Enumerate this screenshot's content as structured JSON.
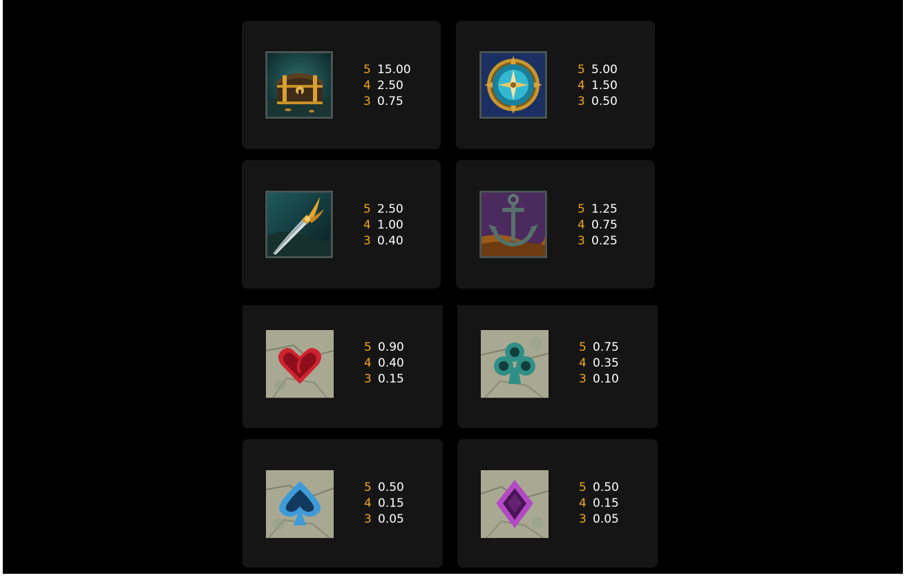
{
  "paytable": {
    "symbols": [
      {
        "name": "treasure-chest",
        "icon": "treasure-chest-icon",
        "pays": [
          {
            "count": "5",
            "value": "15.00"
          },
          {
            "count": "4",
            "value": "2.50"
          },
          {
            "count": "3",
            "value": "0.75"
          }
        ]
      },
      {
        "name": "compass",
        "icon": "compass-icon",
        "pays": [
          {
            "count": "5",
            "value": "5.00"
          },
          {
            "count": "4",
            "value": "1.50"
          },
          {
            "count": "3",
            "value": "0.50"
          }
        ]
      },
      {
        "name": "cutlass",
        "icon": "cutlass-icon",
        "pays": [
          {
            "count": "5",
            "value": "2.50"
          },
          {
            "count": "4",
            "value": "1.00"
          },
          {
            "count": "3",
            "value": "0.40"
          }
        ]
      },
      {
        "name": "anchor",
        "icon": "anchor-icon",
        "pays": [
          {
            "count": "5",
            "value": "1.25"
          },
          {
            "count": "4",
            "value": "0.75"
          },
          {
            "count": "3",
            "value": "0.25"
          }
        ]
      },
      {
        "name": "heart",
        "icon": "heart-icon",
        "pays": [
          {
            "count": "5",
            "value": "0.90"
          },
          {
            "count": "4",
            "value": "0.40"
          },
          {
            "count": "3",
            "value": "0.15"
          }
        ]
      },
      {
        "name": "club",
        "icon": "club-icon",
        "pays": [
          {
            "count": "5",
            "value": "0.75"
          },
          {
            "count": "4",
            "value": "0.35"
          },
          {
            "count": "3",
            "value": "0.10"
          }
        ]
      },
      {
        "name": "spade",
        "icon": "spade-icon",
        "pays": [
          {
            "count": "5",
            "value": "0.50"
          },
          {
            "count": "4",
            "value": "0.15"
          },
          {
            "count": "3",
            "value": "0.05"
          }
        ]
      },
      {
        "name": "diamond",
        "icon": "diamond-icon",
        "pays": [
          {
            "count": "5",
            "value": "0.50"
          },
          {
            "count": "4",
            "value": "0.15"
          },
          {
            "count": "3",
            "value": "0.05"
          }
        ]
      }
    ]
  },
  "colors": {
    "background": "#000000",
    "card": "#151515",
    "count_accent": "#f0a41f",
    "value_text": "#ffffff"
  }
}
